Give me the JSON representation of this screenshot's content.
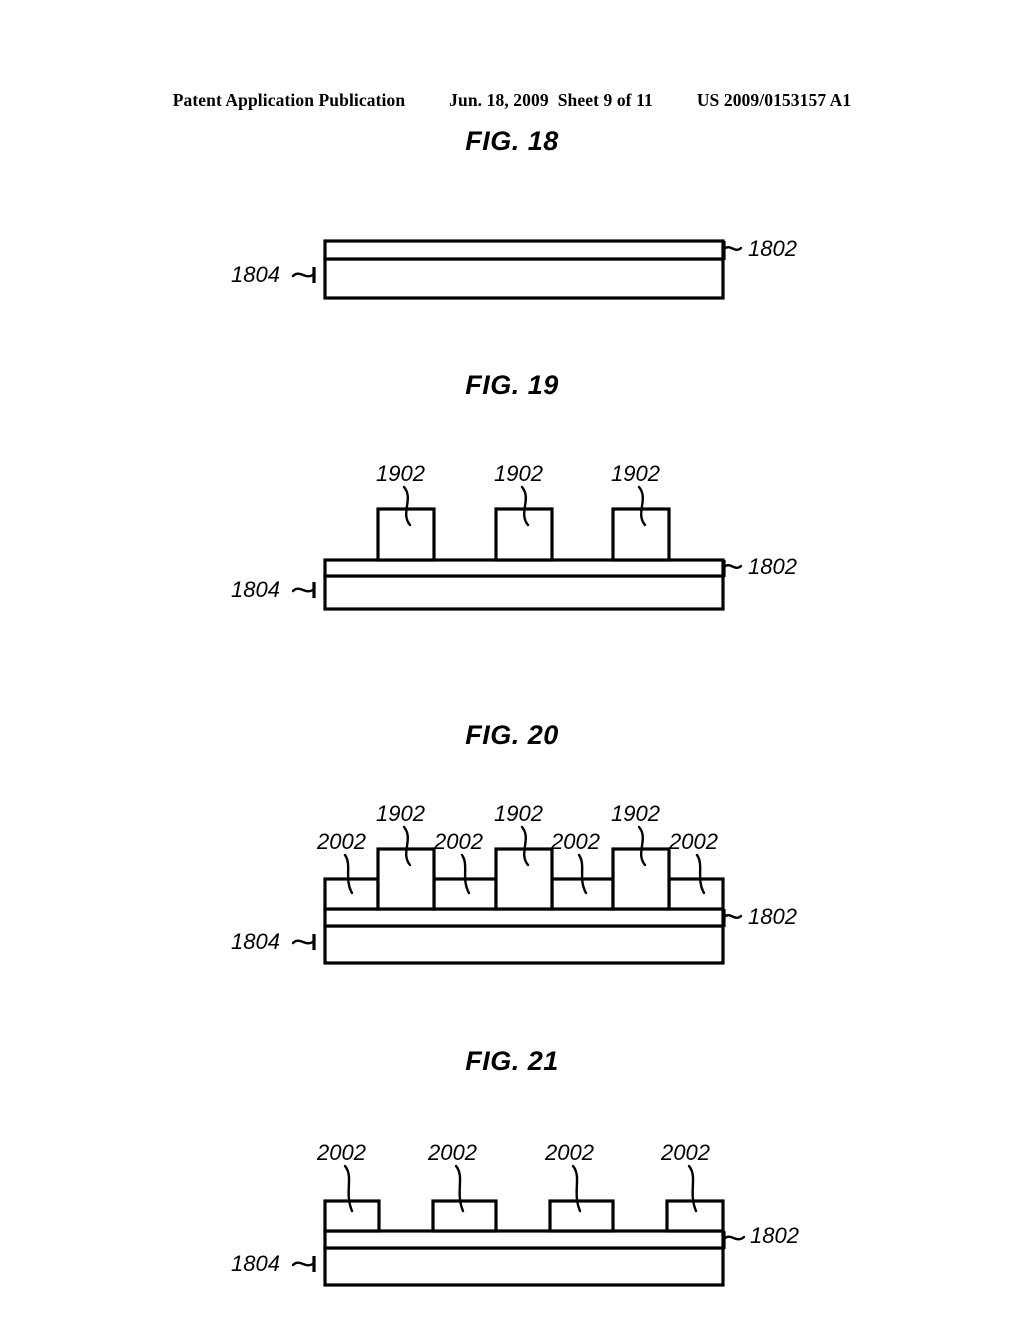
{
  "header": {
    "publication": "Patent Application Publication",
    "date": "Jun. 18, 2009",
    "sheet": "Sheet 9 of 11",
    "patent_number": "US 2009/0153157 A1"
  },
  "figures": [
    {
      "id": "fig-18",
      "title": "FIG. 18",
      "labels": {
        "top_layer": "1802",
        "bottom_layer": "1804"
      }
    },
    {
      "id": "fig-19",
      "title": "FIG. 19",
      "labels": {
        "top_layer": "1802",
        "bottom_layer": "1804",
        "blocks": [
          "1902",
          "1902",
          "1902"
        ]
      }
    },
    {
      "id": "fig-20",
      "title": "FIG. 20",
      "labels": {
        "top_layer": "1802",
        "bottom_layer": "1804",
        "blocks": [
          "1902",
          "1902",
          "1902"
        ],
        "spacers": [
          "2002",
          "2002",
          "2002",
          "2002"
        ]
      }
    },
    {
      "id": "fig-21",
      "title": "FIG. 21",
      "labels": {
        "top_layer": "1802",
        "bottom_layer": "1804",
        "spacers": [
          "2002",
          "2002",
          "2002",
          "2002"
        ]
      }
    }
  ]
}
